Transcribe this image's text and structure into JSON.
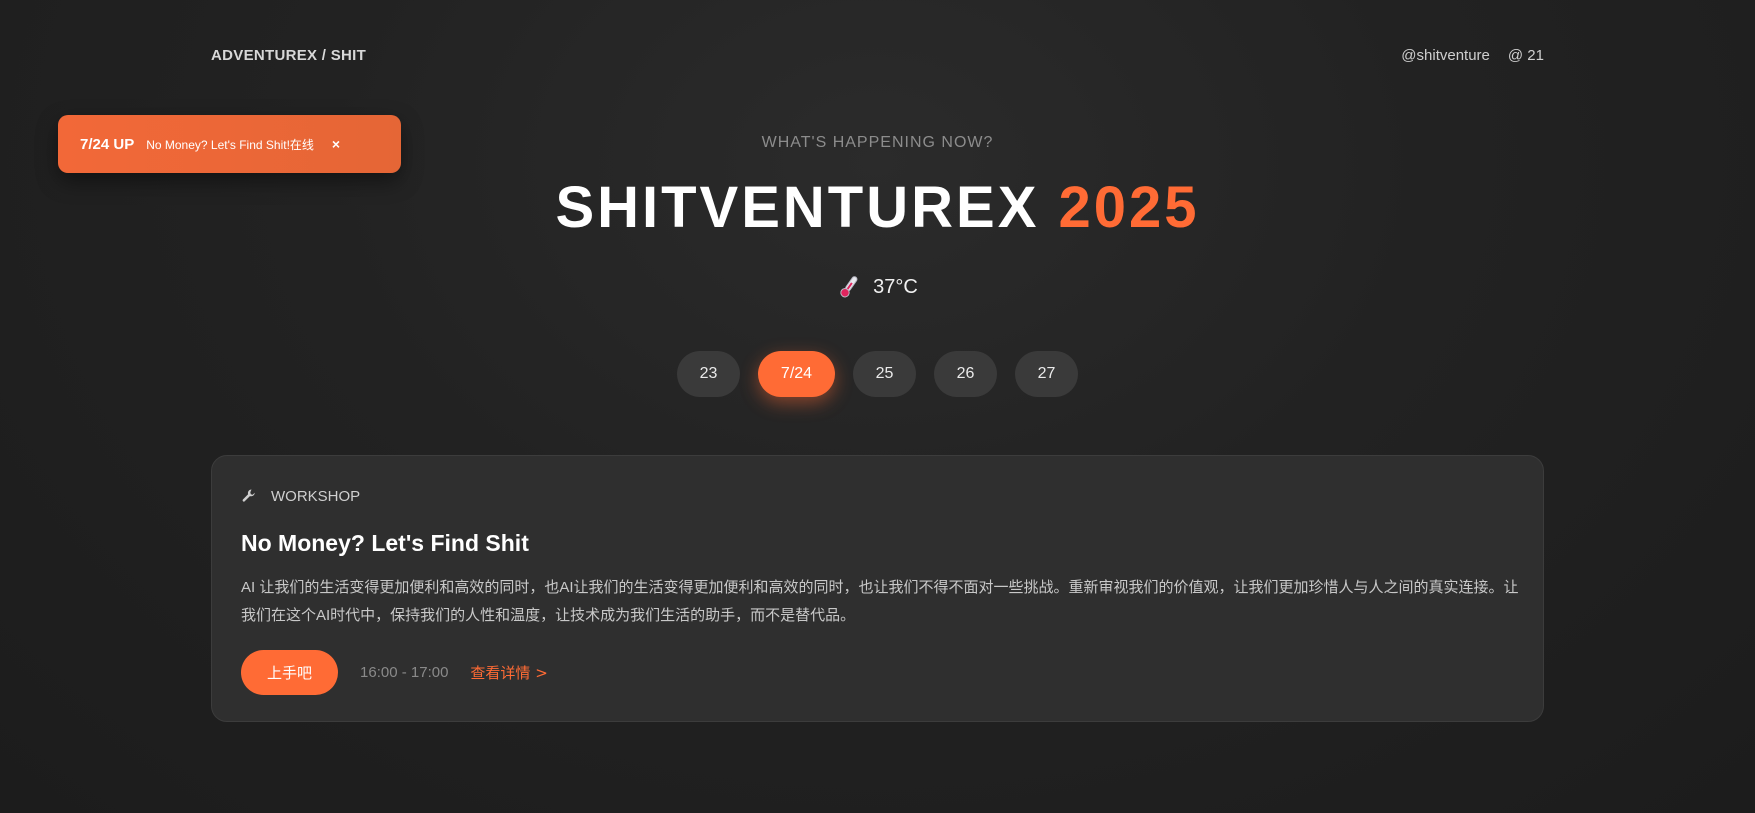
{
  "header": {
    "brand": "ADVENTUREX / SHIT",
    "handle": "@shitventure",
    "count": "@ 21"
  },
  "toast": {
    "badge": "7/24 UP",
    "message": "No Money? Let's Find Shit!在线",
    "close": "×"
  },
  "hero": {
    "eyebrow": "WHAT'S HAPPENING NOW?",
    "title_main": "SHITVENTUREX",
    "title_year": "2025",
    "temperature": "37°C"
  },
  "dates": [
    {
      "label": "23",
      "active": false
    },
    {
      "label": "7/24",
      "active": true
    },
    {
      "label": "25",
      "active": false
    },
    {
      "label": "26",
      "active": false
    },
    {
      "label": "27",
      "active": false
    }
  ],
  "event": {
    "icon": "wrench-icon",
    "category": "WORKSHOP",
    "title": "No Money? Let's Find Shit",
    "description": "AI 让我们的生活变得更加便利和高效的同时，也AI让我们的生活变得更加便利和高效的同时，也让我们不得不面对一些挑战。重新审视我们的价值观，让我们更加珍惜人与人之间的真实连接。让我们在这个AI时代中，保持我们的人性和温度，让技术成为我们生活的助手，而不是替代品。",
    "cta": "上手吧",
    "time": "16:00 - 17:00",
    "details": "查看详情 >"
  },
  "colors": {
    "accent": "#ff6b35",
    "background": "#222222",
    "card": "#2f2f2f",
    "pill": "#3a3a3a"
  }
}
